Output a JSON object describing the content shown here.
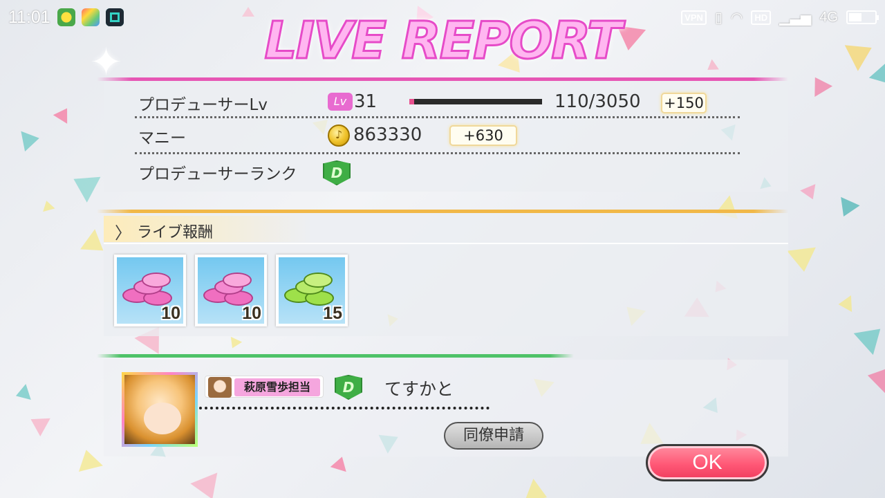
{
  "status_bar": {
    "time": "11:01",
    "vpn": "VPN",
    "hd": "HD",
    "network": "4G",
    "icons": [
      "vpn-icon",
      "vibrate-icon",
      "wifi-icon",
      "hd-icon",
      "signal-icon",
      "battery-icon"
    ]
  },
  "title": "LIVE REPORT",
  "producer": {
    "level_label": "プロデューサーLv",
    "lv_badge": "Lv",
    "level": "31",
    "xp": "110/3050",
    "xp_progress": 0.036,
    "xp_gain": "+150",
    "money_label": "マニー",
    "money": "863330",
    "money_gain": "+630",
    "rank_label": "プロデューサーランク",
    "rank": "D"
  },
  "rewards": {
    "title": "ライブ報酬",
    "items": [
      {
        "name": "pink-coin-stack",
        "qty": "10",
        "color": "#f06fc0"
      },
      {
        "name": "pink-coin-stack",
        "qty": "10",
        "color": "#f06fc0"
      },
      {
        "name": "green-coin-stack",
        "qty": "15",
        "color": "#9ee04a"
      }
    ]
  },
  "friend": {
    "tag": "萩原雪歩担当",
    "rank": "D",
    "name": "てすかと",
    "coworker_button": "同僚申請"
  },
  "ok_button": "OK",
  "colors": {
    "title_pink": "#e64bc8",
    "ok_button": "#ff5876",
    "rank_green": "#3fae45"
  }
}
